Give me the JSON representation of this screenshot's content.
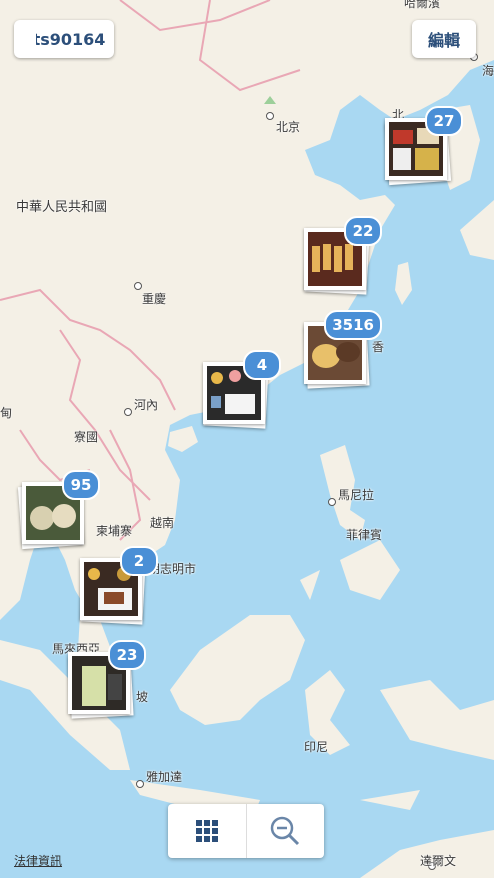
{
  "header": {
    "back_label": "ts90164",
    "edit_label": "編輯"
  },
  "map": {
    "labels": {
      "haerbin": "哈爾濱",
      "hai": "海",
      "beijing": "北京",
      "bei": "北",
      "china": "中華人民共和國",
      "chongqing": "重慶",
      "hong_kong": "香",
      "hanoi": "河內",
      "laos": "寮國",
      "burma": "甸",
      "manila": "馬尼拉",
      "cambodia": "柬埔寨",
      "vietnam": "越南",
      "philippines": "菲律賓",
      "hcmc": "胡志明市",
      "malaysia": "馬來西亞",
      "wen": "坡",
      "indonesia": "印尼",
      "jakarta": "雅加達",
      "darwin": "達爾文"
    },
    "colors": {
      "water": "#a9d8f2",
      "land": "#f4f0e6",
      "border": "#e9a7b5",
      "badge": "#4a8fd6"
    }
  },
  "clusters": [
    {
      "count": "27",
      "photo": "airline-meal-tray"
    },
    {
      "count": "22",
      "photo": "spring-rolls"
    },
    {
      "count": "3516",
      "photo": "pastries"
    },
    {
      "count": "4",
      "photo": "airline-meal-tray"
    },
    {
      "count": "95",
      "photo": "sandwich"
    },
    {
      "count": "2",
      "photo": "airline-meal-tray"
    },
    {
      "count": "23",
      "photo": "green-drink"
    }
  ],
  "controls": {
    "grid_icon": "grid-icon",
    "zoom_out_icon": "zoom-out-icon"
  },
  "footer": {
    "legal_label": "法律資訊"
  }
}
